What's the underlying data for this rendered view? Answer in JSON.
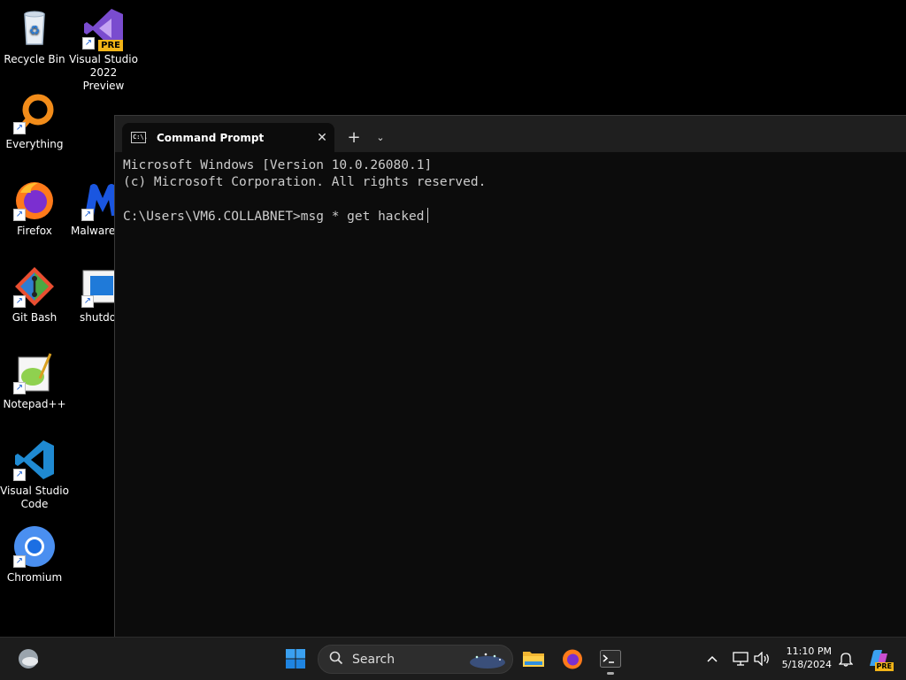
{
  "desktop": {
    "icons": [
      {
        "label": "Recycle Bin",
        "icon": "recycle-bin-icon"
      },
      {
        "label": "Visual Studio\n2022 Preview",
        "icon": "visual-studio-icon",
        "badge": "PRE"
      },
      {
        "label": "Everything",
        "icon": "everything-search-icon"
      },
      {
        "label": "Firefox",
        "icon": "firefox-icon"
      },
      {
        "label": "Malwareb",
        "icon": "malwarebytes-icon"
      },
      {
        "label": "Git Bash",
        "icon": "git-bash-icon"
      },
      {
        "label": "shutdov",
        "icon": "shutdown-shortcut-icon"
      },
      {
        "label": "Notepad++",
        "icon": "notepad-plus-plus-icon"
      },
      {
        "label": "Visual Studio\nCode",
        "icon": "vscode-icon"
      },
      {
        "label": "Chromium",
        "icon": "chromium-icon"
      }
    ]
  },
  "terminal": {
    "tab_title": "Command Prompt",
    "tab_icon_text": "C:\\.",
    "close_glyph": "✕",
    "new_tab_glyph": "+",
    "dropdown_glyph": "⌄",
    "lines": [
      "Microsoft Windows [Version 10.0.26080.1]",
      "(c) Microsoft Corporation. All rights reserved.",
      "",
      "C:\\Users\\VM6.COLLABNET>msg * get hacked"
    ]
  },
  "taskbar": {
    "search_placeholder": "Search",
    "clock_time": "11:10 PM",
    "clock_date": "5/18/2024",
    "copilot_badge": "PRE",
    "icons": [
      "weather-icon",
      "start-icon",
      "search-icon",
      "file-explorer-icon",
      "firefox-icon",
      "terminal-icon",
      "chevron-up-icon",
      "network-icon",
      "volume-icon",
      "notification-bell-icon",
      "copilot-icon"
    ]
  },
  "colors": {
    "desktop_bg": "#000000",
    "terminal_bg": "#0c0c0c",
    "tabbar_bg": "#1f1f1f",
    "taskbar_bg": "#1c1c1c",
    "console_text": "#cccccc"
  }
}
